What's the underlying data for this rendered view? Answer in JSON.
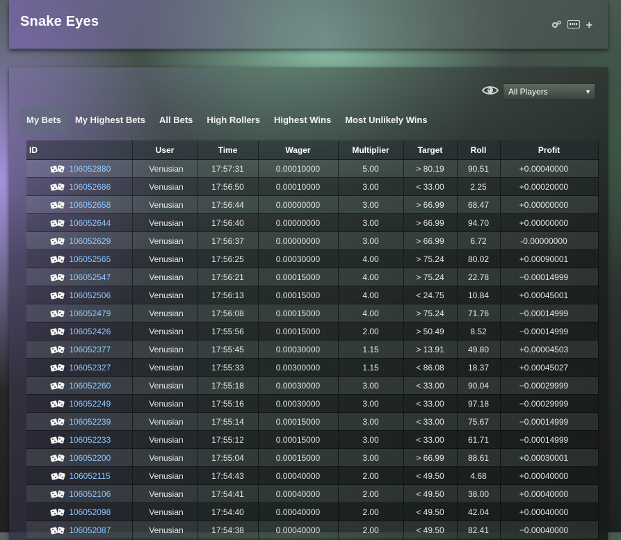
{
  "app": {
    "title": "Snake Eyes"
  },
  "toolbar_icons": [
    "cogs-icon",
    "keyboard-icon",
    "plus-icon"
  ],
  "player_filter": {
    "selected": "All Players"
  },
  "tabs": [
    {
      "label": "My Bets",
      "active": true
    },
    {
      "label": "My Highest Bets",
      "active": false
    },
    {
      "label": "All Bets",
      "active": false
    },
    {
      "label": "High Rollers",
      "active": false
    },
    {
      "label": "Highest Wins",
      "active": false
    },
    {
      "label": "Most Unlikely Wins",
      "active": false
    }
  ],
  "table": {
    "columns": [
      "ID",
      "User",
      "Time",
      "Wager",
      "Multiplier",
      "Target",
      "Roll",
      "Profit"
    ],
    "rows": [
      {
        "id": "106052880",
        "user": "Venusian",
        "time": "17:57:31",
        "wager": "0.00010000",
        "multiplier": "5.00",
        "target": "> 80.19",
        "roll": "90.51",
        "profit": "+0.00040000",
        "win": true
      },
      {
        "id": "106052686",
        "user": "Venusian",
        "time": "17:56:50",
        "wager": "0.00010000",
        "multiplier": "3.00",
        "target": "< 33.00",
        "roll": "2.25",
        "profit": "+0.00020000",
        "win": true
      },
      {
        "id": "106052658",
        "user": "Venusian",
        "time": "17:56:44",
        "wager": "0.00000000",
        "multiplier": "3.00",
        "target": "> 66.99",
        "roll": "68.47",
        "profit": "+0.00000000",
        "win": true
      },
      {
        "id": "106052644",
        "user": "Venusian",
        "time": "17:56:40",
        "wager": "0.00000000",
        "multiplier": "3.00",
        "target": "> 66.99",
        "roll": "94.70",
        "profit": "+0.00000000",
        "win": true
      },
      {
        "id": "106052629",
        "user": "Venusian",
        "time": "17:56:37",
        "wager": "0.00000000",
        "multiplier": "3.00",
        "target": "> 66.99",
        "roll": "6.72",
        "profit": "-0.00000000",
        "win": false
      },
      {
        "id": "106052565",
        "user": "Venusian",
        "time": "17:56:25",
        "wager": "0.00030000",
        "multiplier": "4.00",
        "target": "> 75.24",
        "roll": "80.02",
        "profit": "+0.00090001",
        "win": true
      },
      {
        "id": "106052547",
        "user": "Venusian",
        "time": "17:56:21",
        "wager": "0.00015000",
        "multiplier": "4.00",
        "target": "> 75.24",
        "roll": "22.78",
        "profit": "−0.00014999",
        "win": false
      },
      {
        "id": "106052506",
        "user": "Venusian",
        "time": "17:56:13",
        "wager": "0.00015000",
        "multiplier": "4.00",
        "target": "< 24.75",
        "roll": "10.84",
        "profit": "+0.00045001",
        "win": true
      },
      {
        "id": "106052479",
        "user": "Venusian",
        "time": "17:56:08",
        "wager": "0.00015000",
        "multiplier": "4.00",
        "target": "> 75.24",
        "roll": "71.76",
        "profit": "−0.00014999",
        "win": false
      },
      {
        "id": "106052426",
        "user": "Venusian",
        "time": "17:55:56",
        "wager": "0.00015000",
        "multiplier": "2.00",
        "target": "> 50.49",
        "roll": "8.52",
        "profit": "−0.00014999",
        "win": false
      },
      {
        "id": "106052377",
        "user": "Venusian",
        "time": "17:55:45",
        "wager": "0.00030000",
        "multiplier": "1.15",
        "target": "> 13.91",
        "roll": "49.80",
        "profit": "+0.00004503",
        "win": true
      },
      {
        "id": "106052327",
        "user": "Venusian",
        "time": "17:55:33",
        "wager": "0.00300000",
        "multiplier": "1.15",
        "target": "< 86.08",
        "roll": "18.37",
        "profit": "+0.00045027",
        "win": true
      },
      {
        "id": "106052260",
        "user": "Venusian",
        "time": "17:55:18",
        "wager": "0.00030000",
        "multiplier": "3.00",
        "target": "< 33.00",
        "roll": "90.04",
        "profit": "−0.00029999",
        "win": false
      },
      {
        "id": "106052249",
        "user": "Venusian",
        "time": "17:55:16",
        "wager": "0.00030000",
        "multiplier": "3.00",
        "target": "< 33.00",
        "roll": "97.18",
        "profit": "−0.00029999",
        "win": false
      },
      {
        "id": "106052239",
        "user": "Venusian",
        "time": "17:55:14",
        "wager": "0.00015000",
        "multiplier": "3.00",
        "target": "< 33.00",
        "roll": "75.67",
        "profit": "−0.00014999",
        "win": false
      },
      {
        "id": "106052233",
        "user": "Venusian",
        "time": "17:55:12",
        "wager": "0.00015000",
        "multiplier": "3.00",
        "target": "< 33.00",
        "roll": "61.71",
        "profit": "−0.00014999",
        "win": false
      },
      {
        "id": "106052200",
        "user": "Venusian",
        "time": "17:55:04",
        "wager": "0.00015000",
        "multiplier": "3.00",
        "target": "> 66.99",
        "roll": "88.61",
        "profit": "+0.00030001",
        "win": true
      },
      {
        "id": "106052115",
        "user": "Venusian",
        "time": "17:54:43",
        "wager": "0.00040000",
        "multiplier": "2.00",
        "target": "< 49.50",
        "roll": "4.68",
        "profit": "+0.00040000",
        "win": true
      },
      {
        "id": "106052106",
        "user": "Venusian",
        "time": "17:54:41",
        "wager": "0.00040000",
        "multiplier": "2.00",
        "target": "< 49.50",
        "roll": "38.00",
        "profit": "+0.00040000",
        "win": true
      },
      {
        "id": "106052098",
        "user": "Venusian",
        "time": "17:54:40",
        "wager": "0.00040000",
        "multiplier": "2.00",
        "target": "< 49.50",
        "roll": "42.04",
        "profit": "+0.00040000",
        "win": true
      },
      {
        "id": "106052087",
        "user": "Venusian",
        "time": "17:54:38",
        "wager": "0.00040000",
        "multiplier": "2.00",
        "target": "< 49.50",
        "roll": "82.41",
        "profit": "−0.00040000",
        "win": false
      }
    ]
  },
  "colors": {
    "win": "#5fd06b",
    "loss": "#ff4b4b",
    "link": "#8fc7ff"
  }
}
